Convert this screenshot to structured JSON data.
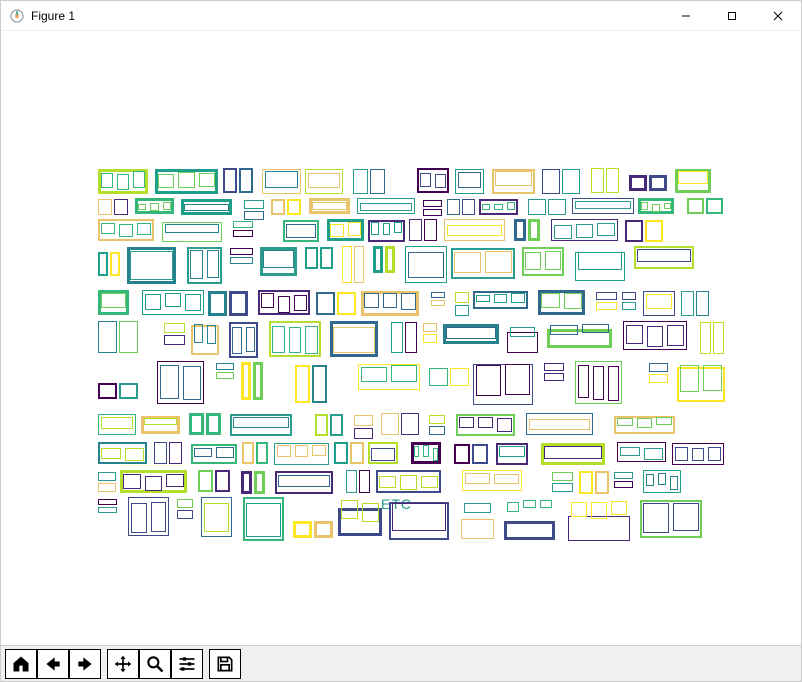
{
  "window": {
    "title": "Figure 1",
    "controls": {
      "minimize": "Minimize",
      "maximize": "Maximize",
      "close": "Close"
    }
  },
  "toolbar": {
    "home": "Home",
    "back": "Back",
    "forward": "Forward",
    "pan": "Pan",
    "zoom": "Zoom",
    "configure": "Configure subplots",
    "save": "Save"
  },
  "plot": {
    "annotation": "ETC",
    "palette": [
      "#440154",
      "#482878",
      "#3e4a89",
      "#31688e",
      "#26828e",
      "#1f9e89",
      "#35b779",
      "#6ece58",
      "#b5de2b",
      "#fde725",
      "#2a9d8f",
      "#e9c46a"
    ]
  },
  "chart_data": {
    "type": "scatter",
    "title": "",
    "xlabel": "",
    "ylabel": "",
    "xlim": [
      0,
      630
    ],
    "ylim": [
      0,
      350
    ],
    "description": "Dense random packing of outlined rectangles (no fill) of varying sizes and border thicknesses. Roughly several hundred rectangles arranged in loose rows. Border colors drawn from a viridis-like palette (dark purple through teal/green to yellow). No axes, ticks, or legend shown. A single text annotation 'ETC' appears near the lower-middle of the plot.",
    "series": [
      {
        "name": "rectangles",
        "note": "Positions/sizes are procedurally random; exact coordinates not labeled in source image.",
        "approx_count": 500
      }
    ]
  }
}
